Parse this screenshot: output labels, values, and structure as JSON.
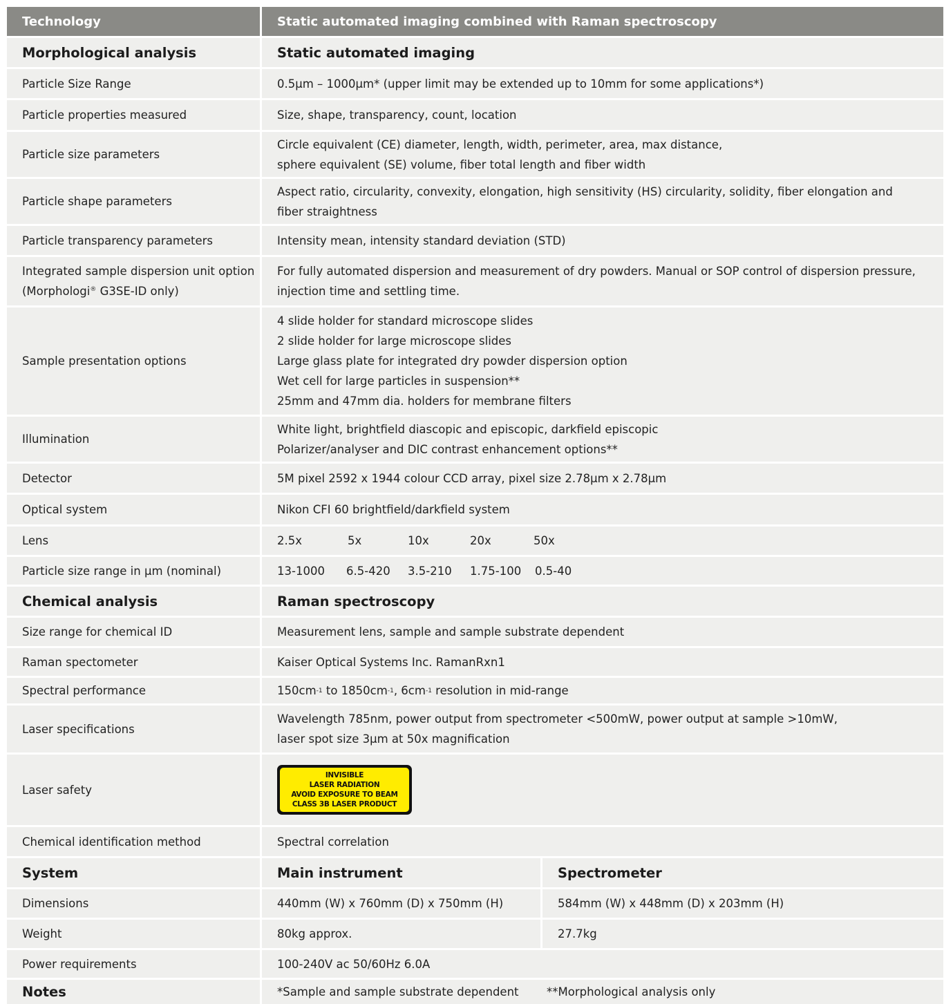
{
  "header": {
    "col1": "Technology",
    "col2": "Static automated imaging combined with Raman spectroscopy"
  },
  "morph": {
    "section": {
      "label": "Morphological analysis",
      "value": "Static automated imaging"
    },
    "size_range": {
      "label": "Particle Size Range",
      "value": "0.5µm – 1000µm* (upper limit may be extended up to 10mm for some applications*)"
    },
    "properties": {
      "label": "Particle properties measured",
      "value": "Size, shape, transparency, count, location"
    },
    "size_params": {
      "label": "Particle size parameters",
      "line1": "Circle equivalent (CE) diameter, length, width, perimeter, area, max distance,",
      "line2": "sphere equivalent (SE) volume, fiber total length and fiber width"
    },
    "shape_params": {
      "label": "Particle shape parameters",
      "line1": "Aspect ratio, circularity, convexity, elongation, high sensitivity (HS) circularity, solidity, fiber elongation and",
      "line2": "fiber straightness"
    },
    "transparency": {
      "label": "Particle transparency parameters",
      "value": "Intensity mean, intensity standard deviation (STD)"
    },
    "dispersion": {
      "label1": "Integrated sample dispersion unit option",
      "label2a": "(Morphologi",
      "label2reg": "®",
      "label2b": " G3SE-ID only)",
      "line1": "For fully automated dispersion and measurement of dry powders. Manual or SOP control of dispersion pressure,",
      "line2": "injection time and settling time."
    },
    "presentation": {
      "label": "Sample presentation options",
      "lines": [
        "4 slide holder for standard microscope slides",
        "2 slide holder for large microscope slides",
        "Large glass plate for integrated dry powder dispersion option",
        "Wet cell for large particles in suspension**",
        "25mm and 47mm dia. holders for membrane filters"
      ]
    },
    "illumination": {
      "label": "Illumination",
      "line1": "White light, brightfield diascopic and episcopic, darkfield episcopic",
      "line2": "Polarizer/analyser and DIC contrast enhancement options**"
    },
    "detector": {
      "label": "Detector",
      "value": "5M pixel 2592 x 1944 colour CCD array, pixel size 2.78µm x 2.78µm"
    },
    "optical": {
      "label": "Optical system",
      "value": "Nikon CFI 60 brightfield/darkfield system"
    },
    "lens": {
      "label": "Lens",
      "values": [
        "2.5x",
        "5x",
        "10x",
        "20x",
        "50x"
      ]
    },
    "nominal": {
      "label": "Particle size range in µm (nominal)",
      "values": [
        "13-1000",
        "6.5-420",
        "3.5-210",
        "1.75-100",
        "0.5-40"
      ]
    }
  },
  "chem": {
    "section": {
      "label": "Chemical analysis",
      "value": "Raman spectroscopy"
    },
    "size_range": {
      "label": "Size range for chemical ID",
      "value": "Measurement lens, sample and sample substrate dependent"
    },
    "spectrometer": {
      "label": "Raman spectometer",
      "value": "Kaiser Optical Systems Inc. RamanRxn1"
    },
    "spectral": {
      "label": "Spectral performance",
      "p1": "150cm",
      "p2": " to 1850cm",
      "p3": ", 6cm",
      "p4": " resolution in mid-range",
      "sup": "-1"
    },
    "laser_spec": {
      "label": "Laser specifications",
      "line1": "Wavelength 785nm, power output from spectrometer <500mW, power output at sample >10mW,",
      "line2": "laser spot size 3µm at 50x magnification"
    },
    "laser_safety": {
      "label": "Laser safety",
      "sign": [
        "INVISIBLE",
        "LASER RADIATION",
        "AVOID EXPOSURE TO BEAM",
        "CLASS 3B LASER PRODUCT"
      ]
    },
    "method": {
      "label": "Chemical identification method",
      "value": "Spectral correlation"
    }
  },
  "system": {
    "section": {
      "label": "System",
      "main": "Main instrument",
      "spec": "Spectrometer"
    },
    "dimensions": {
      "label": "Dimensions",
      "main": "440mm (W) x 760mm (D) x 750mm (H)",
      "spec": "584mm (W) x 448mm (D) x 203mm (H)"
    },
    "weight": {
      "label": "Weight",
      "main": "80kg approx.",
      "spec": "27.7kg"
    },
    "power": {
      "label": "Power requirements",
      "value": "100-240V ac 50/60Hz 6.0A"
    }
  },
  "notes": {
    "label": "Notes",
    "note1": "*Sample and sample substrate dependent",
    "note2": "**Morphological analysis only"
  },
  "colors": {
    "header_bg": "#8a8a86",
    "cell_bg": "#efefed",
    "sign_yellow": "#ffec00"
  }
}
